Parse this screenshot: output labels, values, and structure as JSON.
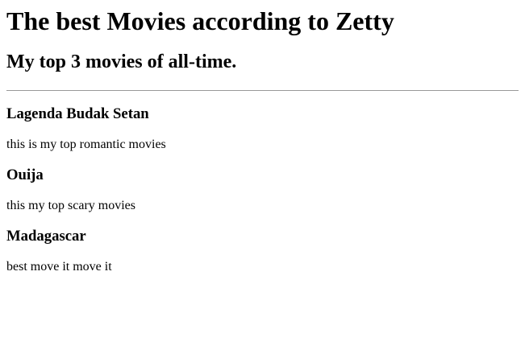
{
  "title": "The best Movies according to Zetty",
  "subtitle": "My top 3 movies of all-time.",
  "movies": [
    {
      "name": "Lagenda Budak Setan",
      "description": "this is my top romantic movies"
    },
    {
      "name": "Ouija",
      "description": "this my top scary movies"
    },
    {
      "name": "Madagascar",
      "description": "best move it move it"
    }
  ]
}
